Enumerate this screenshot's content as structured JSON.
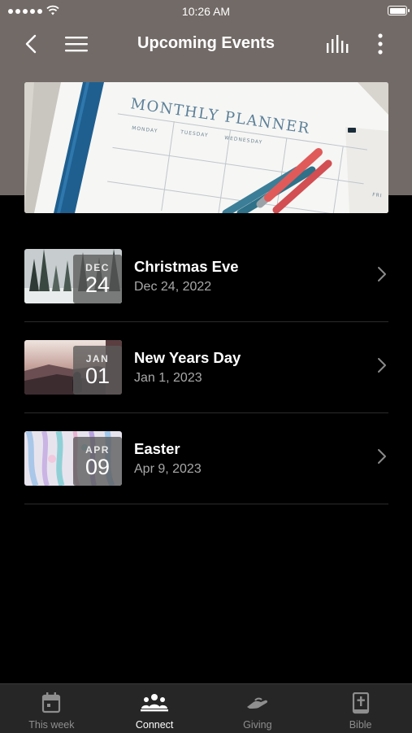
{
  "status_bar": {
    "time": "10:26 AM"
  },
  "header": {
    "title": "Upcoming Events"
  },
  "hero": {
    "planner_text": "MONTHLY PLANNER",
    "days": [
      "MONDAY",
      "TUESDAY",
      "WEDNESDAY",
      "FRI"
    ]
  },
  "events": [
    {
      "month": "DEC",
      "day": "24",
      "name": "Christmas Eve",
      "date": "Dec 24, 2022"
    },
    {
      "month": "JAN",
      "day": "01",
      "name": "New Years Day",
      "date": "Jan 1, 2023"
    },
    {
      "month": "APR",
      "day": "09",
      "name": "Easter",
      "date": "Apr 9, 2023"
    }
  ],
  "tab_bar": {
    "tabs": [
      {
        "label": "This week",
        "icon": "calendar-icon"
      },
      {
        "label": "Connect",
        "icon": "people-icon"
      },
      {
        "label": "Giving",
        "icon": "giving-hand-icon"
      },
      {
        "label": "Bible",
        "icon": "bible-icon"
      }
    ],
    "active": "Connect"
  },
  "colors": {
    "header_bg": "#726a66",
    "background": "#000000",
    "tab_bar_bg": "#262626"
  }
}
